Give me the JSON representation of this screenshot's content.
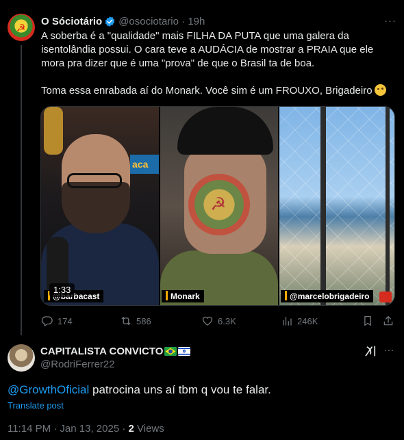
{
  "tweet": {
    "author_name": "O Sóciotário",
    "handle": "@osociotario",
    "time": "19h",
    "text_line1": "A soberba é a \"qualidade\" mais FILHA DA PUTA que uma galera da isentolândia possui. O cara teve a AUDÁCIA de mostrar a PRAIA que ele mora pra dizer que é uma \"prova\" de que o Brasil ta de boa.",
    "text_line2": "Toma essa enrabada aí do Monark. Você sim é um FROUXO, Brigadeiro",
    "media": {
      "duration": "1:33",
      "panels": [
        {
          "label": "@barbacast"
        },
        {
          "label": "Monark"
        },
        {
          "label": "@marcelobrigadeiro"
        }
      ],
      "sign_text": "aca"
    },
    "actions": {
      "replies": "174",
      "retweets": "586",
      "likes": "6.3K",
      "views": "246K"
    }
  },
  "reply": {
    "author_name": "CAPITALISTA CONVICTO",
    "handle": "@RodriFerrer22",
    "mention": "@GrowthOficial",
    "text": " patrocina uns aí tbm q vou te falar.",
    "translate": "Translate post",
    "time": "11:14 PM · Jan 13, 2025 · ",
    "views_count": "2",
    "views_label": " Views"
  },
  "colors": {
    "background": "#000000",
    "text": "#e7e9ea",
    "muted": "#71767b",
    "link": "#1d9bf0",
    "verified": "#1d9bf0",
    "label_bar": "#f2a900"
  },
  "icons": [
    "verified-badge-icon",
    "more-icon",
    "reply-icon",
    "retweet-icon",
    "like-icon",
    "views-icon",
    "bookmark-icon",
    "share-icon",
    "grok-icon",
    "brazil-flag-icon",
    "israel-flag-icon"
  ]
}
